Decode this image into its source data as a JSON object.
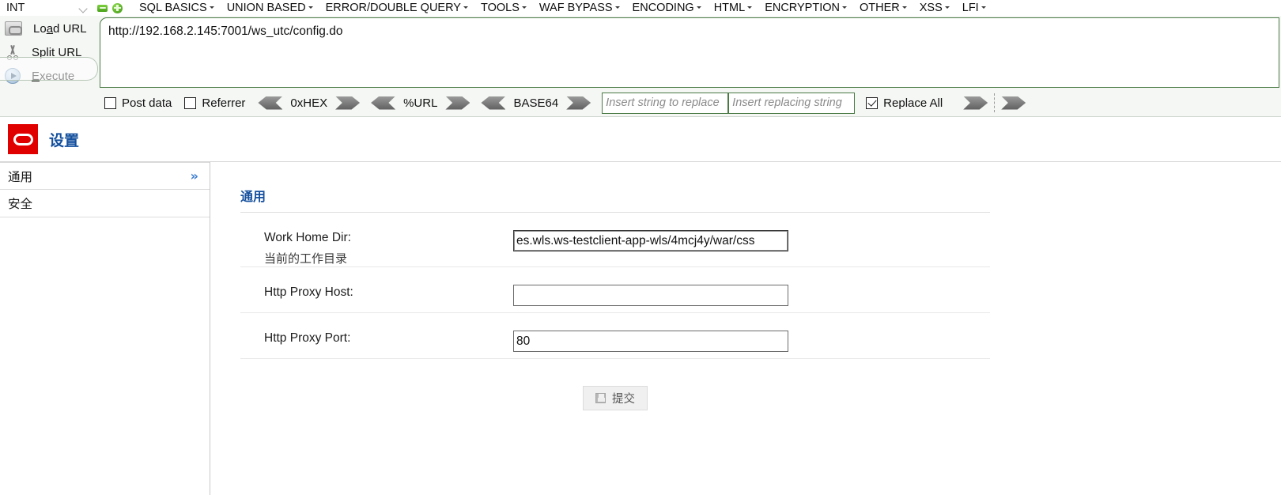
{
  "hackbar": {
    "type_select": {
      "value": "INT"
    },
    "icon_buttons": [
      {
        "name": "minus-button",
        "title": "-"
      },
      {
        "name": "plus-button",
        "title": "+"
      }
    ],
    "menu_items": [
      {
        "label": "SQL BASICS"
      },
      {
        "label": "UNION BASED"
      },
      {
        "label": "ERROR/DOUBLE QUERY"
      },
      {
        "label": "TOOLS"
      },
      {
        "label": "WAF BYPASS"
      },
      {
        "label": "ENCODING"
      },
      {
        "label": "HTML"
      },
      {
        "label": "ENCRYPTION"
      },
      {
        "label": "OTHER"
      },
      {
        "label": "XSS"
      },
      {
        "label": "LFI"
      }
    ],
    "actions": [
      {
        "icon": "load-url-icon",
        "label_pre": "Lo",
        "label_key": "a",
        "label_post": "d URL"
      },
      {
        "icon": "split-url-icon",
        "label_pre": "",
        "label_key": "S",
        "label_post": "plit URL"
      },
      {
        "icon": "execute-icon",
        "label_pre": "",
        "label_key": "E",
        "label_post": "xecute"
      }
    ],
    "url": "http://192.168.2.145:7001/ws_utc/config.do",
    "options": {
      "post_data": {
        "label": "Post data",
        "checked": false
      },
      "referrer": {
        "label": "Referrer",
        "checked": false
      },
      "encoders": [
        {
          "label": "0xHEX"
        },
        {
          "label": "%URL"
        },
        {
          "label": "BASE64"
        }
      ],
      "replace_search": {
        "value": "",
        "placeholder": "Insert string to replace"
      },
      "replace_with": {
        "value": "",
        "placeholder": "Insert replacing string"
      },
      "replace_all": {
        "label": "Replace All",
        "checked": true
      }
    }
  },
  "webpage": {
    "logo": "oracle-logo",
    "title": "设置",
    "sidebar": [
      {
        "label": "通用",
        "chevron": "»",
        "selected": true
      },
      {
        "label": "安全",
        "chevron": "",
        "selected": false
      }
    ],
    "section_title": "通用",
    "fields": [
      {
        "label_en": "Work Home Dir:",
        "label_cn": "当前的工作目录",
        "value": "es.wls.ws-testclient-app-wls/4mcj4y/war/css",
        "focused": true
      },
      {
        "label_en": "Http Proxy Host:",
        "label_cn": "",
        "value": "",
        "focused": false
      },
      {
        "label_en": "Http Proxy Port:",
        "label_cn": "",
        "value": "80",
        "focused": false
      }
    ],
    "submit": {
      "label": "提交",
      "icon": "save-icon"
    }
  }
}
